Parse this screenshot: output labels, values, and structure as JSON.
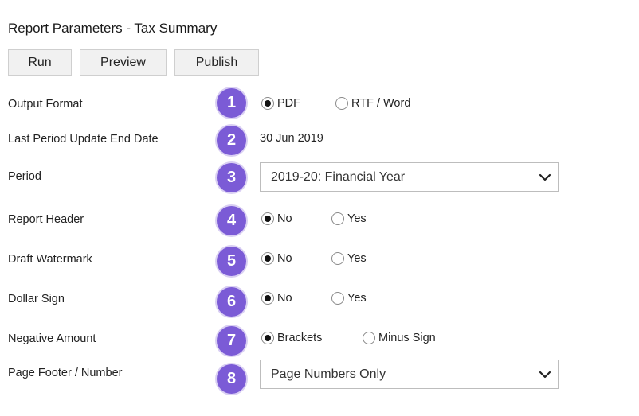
{
  "header": {
    "title": "Report Parameters - Tax Summary"
  },
  "toolbar": {
    "run_label": "Run",
    "preview_label": "Preview",
    "publish_label": "Publish"
  },
  "colors": {
    "badge": "#7b5bd6",
    "badge_ring": "#d9cff3"
  },
  "params": {
    "output_format": {
      "label": "Output Format",
      "step": "1",
      "options": [
        "PDF",
        "RTF / Word"
      ],
      "selected": "PDF"
    },
    "last_period": {
      "label": "Last Period Update End Date",
      "step": "2",
      "value": "30 Jun 2019"
    },
    "period": {
      "label": "Period",
      "step": "3",
      "value": "2019-20: Financial Year"
    },
    "report_header": {
      "label": "Report Header",
      "step": "4",
      "options": [
        "No",
        "Yes"
      ],
      "selected": "No"
    },
    "draft_watermark": {
      "label": "Draft Watermark",
      "step": "5",
      "options": [
        "No",
        "Yes"
      ],
      "selected": "No"
    },
    "dollar_sign": {
      "label": "Dollar Sign",
      "step": "6",
      "options": [
        "No",
        "Yes"
      ],
      "selected": "No"
    },
    "negative_amount": {
      "label": "Negative Amount",
      "step": "7",
      "options": [
        "Brackets",
        "Minus Sign"
      ],
      "selected": "Brackets"
    },
    "page_footer": {
      "label": "Page Footer / Number",
      "step": "8",
      "value": "Page Numbers Only"
    }
  }
}
